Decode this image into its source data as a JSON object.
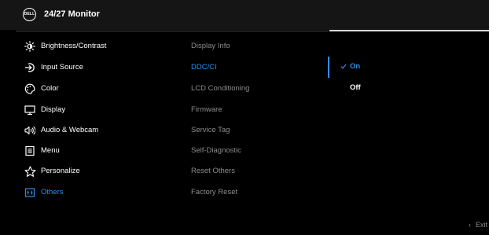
{
  "header": {
    "logo_text": "DELL",
    "title": "24/27 Monitor"
  },
  "main_menu": [
    {
      "label": "Brightness/Contrast",
      "icon": "brightness-icon",
      "active": false
    },
    {
      "label": "Input Source",
      "icon": "input-source-icon",
      "active": false
    },
    {
      "label": "Color",
      "icon": "color-icon",
      "active": false
    },
    {
      "label": "Display",
      "icon": "display-icon",
      "active": false
    },
    {
      "label": "Audio & Webcam",
      "icon": "audio-webcam-icon",
      "active": false
    },
    {
      "label": "Menu",
      "icon": "menu-icon",
      "active": false
    },
    {
      "label": "Personalize",
      "icon": "star-icon",
      "active": false
    },
    {
      "label": "Others",
      "icon": "others-icon",
      "active": true
    }
  ],
  "sub_menu": [
    {
      "label": "Display Info",
      "active": false
    },
    {
      "label": "DDC/CI",
      "active": true
    },
    {
      "label": "LCD Conditioning",
      "active": false
    },
    {
      "label": "Firmware",
      "active": false
    },
    {
      "label": "Service Tag",
      "active": false
    },
    {
      "label": "Self-Diagnostic",
      "active": false
    },
    {
      "label": "Reset Others",
      "active": false
    },
    {
      "label": "Factory Reset",
      "active": false
    }
  ],
  "options": {
    "on_label": "On",
    "off_label": "Off",
    "selected": "On"
  },
  "footer": {
    "exit_label": "Exit"
  },
  "colors": {
    "accent": "#2f8fe6",
    "header_bg": "#151515",
    "dim_text": "#8c8c8c",
    "background": "#000000"
  }
}
